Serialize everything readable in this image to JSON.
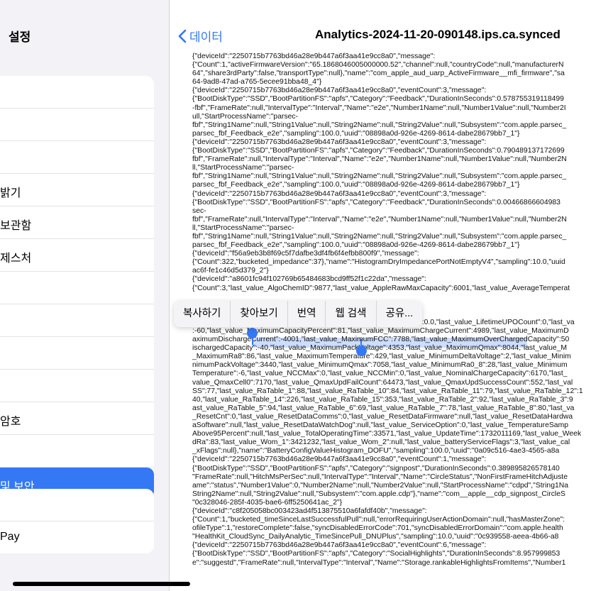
{
  "sidebar": {
    "title": "설정",
    "group1": [
      "",
      "",
      "",
      "밝기",
      "보관함",
      "제스처",
      "",
      "",
      "",
      ""
    ],
    "group1b": [
      "암호",
      "",
      "및 보안"
    ],
    "group2": [
      "",
      "Pay"
    ]
  },
  "nav": {
    "back_label": "데이터",
    "title": "Analytics-2024-11-20-090148.ips.ca.synced"
  },
  "menu": {
    "items": [
      "복사하기",
      "찾아보기",
      "번역",
      "웹 검색",
      "공유..."
    ]
  },
  "lines": [
    "{\"deviceId\":\"2250715b7763bd46a28e9b447a6f3aa41e9cc8a0\",\"message\":",
    "{\"Count\":1,\"activeFirmwareVersion\":\"65.1868046005000000.52\",\"channel\":null,\"countryCode\":null,\"manufacturerN",
    "64\",\"share3rdParty\":false,\"transportType\":null},\"name\":\"com_apple_aud_uarp_ActiveFirmware__mfi_firmware\",\"sa",
    "64-9ad8-47ad-a765-5ecee91bba48_4\"}",
    "{\"deviceId\":\"2250715b7763bd46a28e9b447a6f3aa41e9cc8a0\",\"eventCount\":3,\"message\":",
    "{\"BootDiskType\":\"SSD\",\"BootPartitionFS\":\"apfs\",\"Category\":\"Feedback\",\"DurationInSeconds\":0.578755319118499",
    "-fbf\",\"FrameRate\":null,\"IntervalType\":\"Interval\",\"Name\":\"e2e\",\"Number1Name\":null,\"Number1Value\":null,\"Number2I",
    "ull,\"StartProcessName\":\"parsec-",
    "fbf\",\"String1Name\":null,\"String1Value\":null,\"String2Name\":null,\"String2Value\":null,\"Subsystem\":\"com.apple.parsec_",
    "parsec_fbf_Feedback_e2e\",\"sampling\":100.0,\"uuid\":\"08898a0d-926e-4269-8614-dabe28679bb7_1\"}",
    "{\"deviceId\":\"2250715b7763bd46a28e9b447a6f3aa41e9cc8a0\",\"eventCount\":3,\"message\":",
    "{\"BootDiskType\":\"SSD\",\"BootPartitionFS\":\"apfs\",\"Category\":\"Feedback\",\"DurationInSeconds\":0.790489137172699",
    "fbf\",\"FrameRate\":null,\"IntervalType\":\"Interval\",\"Name\":\"e2e\",\"Number1Name\":null,\"Number1Value\":null,\"Number2N",
    "ll,\"StartProcessName\":\"parsec-",
    "fbf\",\"String1Name\":null,\"String1Value\":null,\"String2Name\":null,\"String2Value\":null,\"Subsystem\":\"com.apple.parsec_",
    "parsec_fbf_Feedback_e2e\",\"sampling\":100.0,\"uuid\":\"08898a0d-926e-4269-8614-dabe28679bb7_1\"}",
    "{\"deviceId\":\"2250715b7763bd46a28e9b447a6f3aa41e9cc8a0\",\"eventCount\":3,\"message\":",
    "{\"BootDiskType\":\"SSD\",\"BootPartitionFS\":\"apfs\",\"Category\":\"Feedback\",\"DurationInSeconds\":0.00466866604983",
    "sec-",
    "fbf\",\"FrameRate\":null,\"IntervalType\":\"Interval\",\"Name\":\"e2e\",\"Number1Name\":null,\"Number1Value\":null,\"Number2N",
    "ll,\"StartProcessName\":\"parsec-",
    "fbf\",\"String1Name\":null,\"String1Value\":null,\"String2Name\":null,\"String2Value\":null,\"Subsystem\":\"com.apple.parsec_",
    "parsec_fbf_Feedback_e2e\",\"sampling\":100.0,\"uuid\":\"08898a0d-926e-4269-8614-dabe28679bb7_1\"}",
    "{\"deviceId\":\"f56a9eb3b8f69c5f7dafbe3df4fb6f4efbb800f9\",\"message\":",
    "{\"Count\":322,\"bucketed_impedance\":37},\"name\":\"HistogramDryImpedancePortNotEmptyV4\",\"sampling\":10.0,\"uuid",
    "ac6f-fe1c46d5d379_2\"}",
    "{\"deviceId\":\"a8601fc94f102769b65484683bcd9ff52f1c22da\",\"message\":",
    "{\"Count\":3,\"last_value_AlgoChemID\":9877,\"last_value_AppleRawMaxCapacity\":6001,\"last_value_AverageTemperat",
    "",
    "",
    "",
    "ue_KioskModeLastHighSocHours\":0,\"last_value_LastUPOTimestamp\":0.0,\"last_value_LifetimeUPOCount\":0,\"last_va",
    ":-60,\"last_value_MaximumCapacityPercent\":81,\"last_value_MaximumChargeCurrent\":4989,\"last_value_MaximumD",
    "aximumDischargeCurrent\":-4001,\"last_value_MaximumFCC\":7788,\"last_value_MaximumOverChargedCapacity\":50",
    "ischargedCapacity\":-40,\"last_value_MaximumPackVoltage\":4353,\"last_value_MaximumQmax\":8044,\"last_value_M",
    "_MaximumRa8\":86,\"last_value_MaximumTemperature\":429,\"last_value_MinimumDeltaVoltage\":2,\"last_value_Minim",
    "nimumPackVoltage\":3440,\"last_value_MinimumQmax\":7058,\"last_value_MinimumRa0_8\":28,\"last_value_Minimum",
    "Temperature\":-6,\"last_value_NCCMax\":0,\"last_value_NCCMin\":0,\"last_value_NominalChargeCapacity\":6170,\"last_",
    "value_QmaxCell0\":7170,\"last_value_QmaxUpdFailCount\":64473,\"last_value_QmaxUpdSuccessCount\":552,\"last_val",
    "SS\":77,\"last_value_RaTable_1\":88,\"last_value_RaTable_10\":84,\"last_value_RaTable_11\":79,\"last_value_RaTable_12\":1",
    "40,\"last_value_RaTable_14\":226,\"last_value_RaTable_15\":353,\"last_value_RaTable_2\":92,\"last_value_RaTable_3\":9",
    "ast_value_RaTable_5\":94,\"last_value_RaTable_6\":69,\"last_value_RaTable_7\":78,\"last_value_RaTable_8\":80,\"last_va",
    "_ResetCnt\":0,\"last_value_ResetDataComms\":0,\"last_value_ResetDataFirmware\":null,\"last_value_ResetDataHardwa",
    "aSoftware\":null,\"last_value_ResetDataWatchDog\":null,\"last_value_ServiceOption\":0,\"last_value_TemperatureSamp",
    "Above95Percent\":null,\"last_value_TotalOperatingTime\":33571,\"last_value_UpdateTime\":1732011169,\"last_value_Week",
    "dRa\":83,\"last_value_Wom_1\":3421232,\"last_value_Wom_2\":null,\"last_value_batteryServiceFlags\":3,\"last_value_cal",
    "_xFlags\":null},\"name\":\"BatteryConfigValueHistogram_DOFU\",\"sampling\":100.0,\"uuid\":\"0a09c516-4ae3-4565-a8a",
    "{\"deviceId\":\"2250715b7763bd46a28e9b447a6f3aa41e9cc8a0\",\"eventCount\":1,\"message\":",
    "{\"BootDiskType\":\"SSD\",\"BootPartitionFS\":\"apfs\",\"Category\":\"signpost\",\"DurationInSeconds\":0.389895826578140",
    "\"FrameRate\":null,\"HitchMsPerSec\":null,\"IntervalType\":\"Interval\",\"Name\":\"CircleStatus\",\"NonFirstFrameHitchAdjuste",
    "ame\":\"status\",\"Number1Value\":0,\"Number2Name\":null,\"Number2Value\":null,\"StartProcessName\":\"cdpd\",\"String1Na",
    "String2Name\":null,\"String2Value\":null,\"Subsystem\":\"com.apple.cdp\"},\"name\":\"com__apple__cdp_signpost_CircleS",
    "\"0c328046-285f-4035-bae6-6ff5250641ac_2\"}",
    "{\"deviceId\":\"c8f205058bc003423ad4f513875510a6fafdf40b\",\"message\":",
    "{\"Count\":1,\"bucketed_timeSinceLastSuccessfulPull\":null,\"errorRequiringUserActionDomain\":null,\"hasMasterZone\":",
    "ofileType\":1,\"restoreComplete\":false,\"syncDisabledErrorCode\":701,\"syncDisabledErrorDomain\":\"com.apple.health",
    "\"HealthKit_CloudSync_DailyAnalytic_TimeSincePull_DNUPlus\",\"sampling\":10.0,\"uuid\":\"0c939558-aeea-4b66-a8",
    "{\"deviceId\":\"2250715b7763bd46a28e9b447a6f3aa41e9cc8a0\",\"eventCount\":6,\"message\":",
    "{\"BootDiskType\":\"SSD\",\"BootPartitionFS\":\"apfs\",\"Category\":\"SocialHighlights\",\"DurationInSeconds\":8.957999853",
    "e\":\"suggestd\",\"FrameRate\":null,\"IntervalType\":\"Interval\",\"Name\":\"Storage.rankableHighlightsFromItems\",\"Number1"
  ]
}
